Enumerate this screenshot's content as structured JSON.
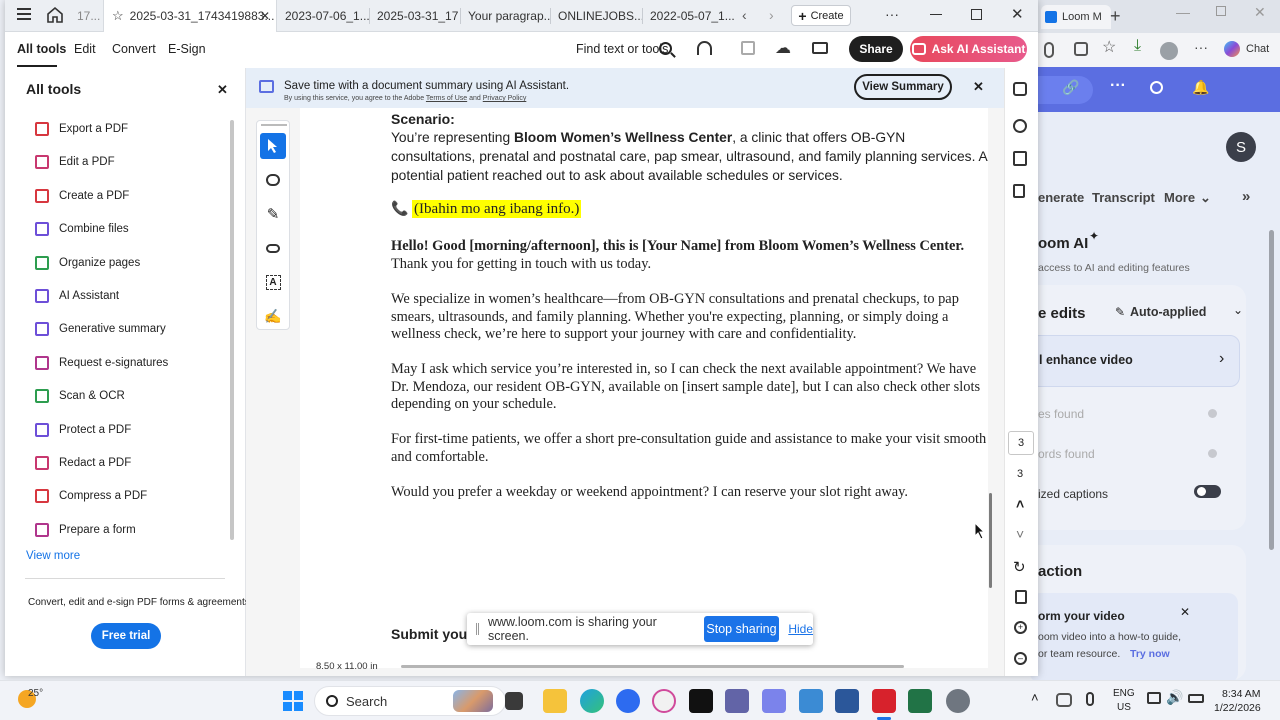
{
  "bg_browser": {
    "tab_label": "Loom M",
    "chat_label": "Chat",
    "avatar_letter": "S",
    "nav": [
      "enerate",
      "Transcript",
      "More"
    ],
    "ai_title": "oom AI",
    "ai_sub": "access to AI and editing features",
    "edits_title": "e edits",
    "auto_applied": "Auto-applied",
    "enhance": "l enhance video",
    "fillers": "es found",
    "silences": "ords found",
    "captions": "ized captions",
    "action_title": "action",
    "transform_title": "orm your video",
    "transform_body_1": "oom video into a how-to guide,",
    "transform_body_2": "or team resource.",
    "try_now": "Try now"
  },
  "tabs": [
    {
      "label": "17..."
    },
    {
      "label": "2025-03-31_1743419883..."
    },
    {
      "label": "2023-07-06_1..."
    },
    {
      "label": "2025-03-31_17..."
    },
    {
      "label": "Your paragrap..."
    },
    {
      "label": "ONLINEJOBS..."
    },
    {
      "label": "2022-05-07_1..."
    }
  ],
  "create_label": "Create",
  "menu": {
    "all_tools": "All tools",
    "edit": "Edit",
    "convert": "Convert",
    "esign": "E-Sign",
    "find": "Find text or tools",
    "share": "Share",
    "ai_assistant": "Ask AI Assistant"
  },
  "left_panel": {
    "title": "All tools",
    "items": [
      {
        "label": "Export a PDF",
        "color": "#d7373f"
      },
      {
        "label": "Edit a PDF",
        "color": "#c8386f"
      },
      {
        "label": "Create a PDF",
        "color": "#d7373f"
      },
      {
        "label": "Combine files",
        "color": "#6d4fd8"
      },
      {
        "label": "Organize pages",
        "color": "#2d9d4f"
      },
      {
        "label": "AI Assistant",
        "color": "#6d4fd8"
      },
      {
        "label": "Generative summary",
        "color": "#6d4fd8"
      },
      {
        "label": "Request e-signatures",
        "color": "#b0368c"
      },
      {
        "label": "Scan & OCR",
        "color": "#2d9d4f"
      },
      {
        "label": "Protect a PDF",
        "color": "#6d4fd8"
      },
      {
        "label": "Redact a PDF",
        "color": "#c8386f"
      },
      {
        "label": "Compress a PDF",
        "color": "#d7373f"
      },
      {
        "label": "Prepare a form",
        "color": "#b0368c"
      }
    ],
    "view_more": "View more",
    "footer": "Convert, edit and e-sign PDF forms & agreements",
    "free_trial": "Free trial"
  },
  "banner": {
    "title": "Save time with a document summary using AI Assistant.",
    "sub_prefix": "By using this service, you agree to the Adobe",
    "terms": "Terms of Use",
    "and": "and",
    "privacy": "Privacy Policy",
    "view_summary": "View Summary"
  },
  "doc": {
    "scenario_heading": "Scenario:",
    "scenario_pre": "You’re representing ",
    "clinic": "Bloom Women’s Wellness Center",
    "scenario_post": ", a clinic that offers OB-GYN consultations, prenatal and postnatal care, pap smear, ultrasound, and family planning services. A potential patient reached out to ask about available schedules or services.",
    "highlight": "(Ibahin mo ang ibang info.)",
    "greeting_bold": "Hello! Good [morning/afternoon], this is [Your Name] from Bloom Women’s Wellness Center.",
    "greeting_rest": " Thank you for getting in touch with us today.",
    "para1": "We specialize in women’s healthcare—from OB-GYN consultations and prenatal checkups, to pap smears, ultrasounds, and family planning. Whether you're expecting, planning, or simply doing a wellness check, we’re here to support your journey with care and confidentiality.",
    "para2": "May I ask which service you’re interested in, so I can check the next available appointment? We have Dr. Mendoza, our resident OB-GYN, available on [insert sample date], but I can also check other slots depending on your schedule.",
    "para3": "For first-time patients, we offer a short pre-consultation guide and assistance to make your visit smooth and comfortable.",
    "para4": "Would you prefer a weekday or weekend appointment? I can reserve your slot right away.",
    "submit_partial": "Submit your",
    "page_size": "8.50 x 11.00 in"
  },
  "page_nav": {
    "current": "3",
    "total": "3"
  },
  "share_bar": {
    "message": "www.loom.com is sharing your screen.",
    "stop": "Stop sharing",
    "hide": "Hide"
  },
  "taskbar": {
    "weather": "25°",
    "search": "Search",
    "lang_1": "ENG",
    "lang_2": "US",
    "time": "8:34 AM",
    "date": "1/22/2026"
  },
  "colors": {
    "accent_blue": "#1473e6",
    "ai_gradient_start": "#e8495d",
    "highlight": "#ffff00",
    "loom_purple": "#5b6ee1"
  }
}
